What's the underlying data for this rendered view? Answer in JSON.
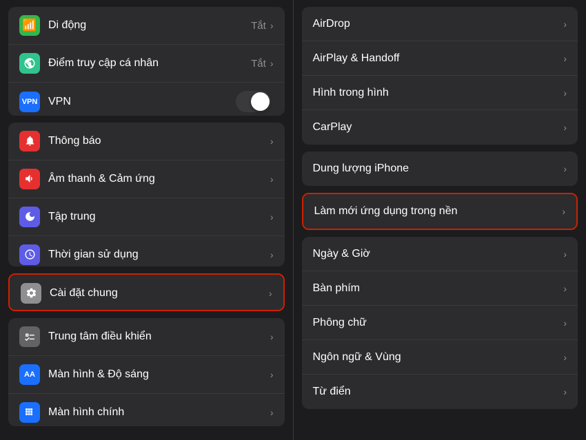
{
  "left": {
    "sections": [
      {
        "id": "top-group",
        "rows": [
          {
            "id": "di-dong",
            "icon": "📱",
            "iconBg": "#30b94d",
            "label": "Di động",
            "value": "Tắt",
            "showChevron": true
          },
          {
            "id": "diem-truy-cap",
            "icon": "🔗",
            "iconBg": "#30c38e",
            "label": "Điểm truy cập cá nhân",
            "value": "Tắt",
            "showChevron": true
          },
          {
            "id": "vpn",
            "icon": "VPN",
            "iconBg": "#1a6fff",
            "label": "VPN",
            "value": "",
            "showToggle": true,
            "toggleOn": false
          }
        ]
      },
      {
        "id": "middle-group",
        "rows": [
          {
            "id": "thong-bao",
            "icon": "🔔",
            "iconBg": "#e63030",
            "label": "Thông báo",
            "value": "",
            "showChevron": true
          },
          {
            "id": "am-thanh",
            "icon": "🔊",
            "iconBg": "#e63030",
            "label": "Âm thanh & Cảm ứng",
            "value": "",
            "showChevron": true
          },
          {
            "id": "tap-trung",
            "icon": "🌙",
            "iconBg": "#5e5ce6",
            "label": "Tập trung",
            "value": "",
            "showChevron": true
          },
          {
            "id": "thoi-gian",
            "icon": "⏳",
            "iconBg": "#5e5ce6",
            "label": "Thời gian sử dụng",
            "value": "",
            "showChevron": true
          }
        ]
      },
      {
        "id": "cai-dat-group",
        "highlighted": true,
        "rows": [
          {
            "id": "cai-dat-chung",
            "icon": "⚙️",
            "iconBg": "#8e8e93",
            "label": "Cài đặt chung",
            "value": "",
            "showChevron": true
          }
        ]
      },
      {
        "id": "bottom-group",
        "rows": [
          {
            "id": "trung-tam",
            "icon": "🔳",
            "iconBg": "#636366",
            "label": "Trung tâm điều khiển",
            "value": "",
            "showChevron": true
          },
          {
            "id": "man-hinh-do-sang",
            "icon": "AA",
            "iconBg": "#1a6fff",
            "label": "Màn hình & Độ sáng",
            "value": "",
            "showChevron": true
          },
          {
            "id": "man-hinh-chinh",
            "icon": "⊞",
            "iconBg": "#1a6fff",
            "label": "Màn hình chính",
            "value": "",
            "showChevron": true
          }
        ]
      }
    ]
  },
  "right": {
    "sections": [
      {
        "id": "right-group-1",
        "rows": [
          {
            "id": "airdrop",
            "label": "AirDrop",
            "showChevron": true
          },
          {
            "id": "airplay-handoff",
            "label": "AirPlay & Handoff",
            "showChevron": true
          },
          {
            "id": "hinh-trong-hinh",
            "label": "Hình trong hình",
            "showChevron": true
          },
          {
            "id": "carplay",
            "label": "CarPlay",
            "showChevron": true
          }
        ]
      },
      {
        "id": "right-group-2",
        "rows": [
          {
            "id": "dung-luong",
            "label": "Dung lượng iPhone",
            "showChevron": true
          }
        ]
      },
      {
        "id": "right-group-3",
        "highlighted": true,
        "rows": [
          {
            "id": "lam-moi",
            "label": "Làm mới ứng dụng trong nền",
            "showChevron": true
          }
        ]
      },
      {
        "id": "right-group-4",
        "rows": [
          {
            "id": "ngay-gio",
            "label": "Ngày & Giờ",
            "showChevron": true
          },
          {
            "id": "ban-phim",
            "label": "Bàn phím",
            "showChevron": true
          },
          {
            "id": "phong-chu",
            "label": "Phông chữ",
            "showChevron": true
          },
          {
            "id": "ngon-ngu",
            "label": "Ngôn ngữ & Vùng",
            "showChevron": true
          },
          {
            "id": "tu-dien",
            "label": "Từ điển",
            "showChevron": true
          }
        ]
      }
    ]
  },
  "icons": {
    "di-dong": "📶",
    "diem-truy-cap": "🔗",
    "vpn-text": "VPN",
    "thong-bao": "🔔",
    "am-thanh": "🔊",
    "tap-trung": "🌙",
    "thoi-gian": "⏳",
    "cai-dat-chung": "⚙️",
    "trung-tam": "⊞",
    "man-hinh-do-sang": "AA",
    "man-hinh-chinh": "⊞"
  }
}
